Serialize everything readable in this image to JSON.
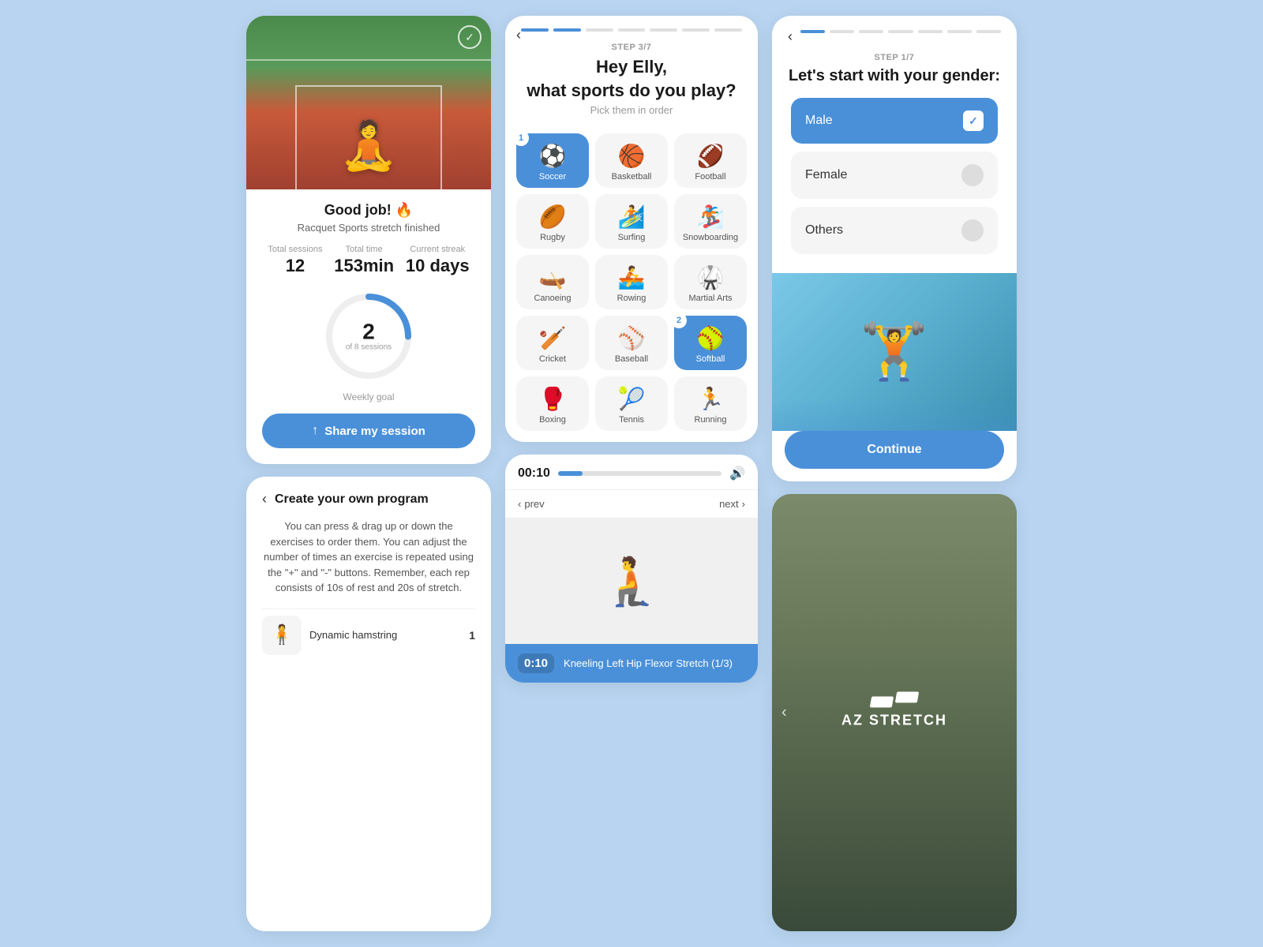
{
  "col_left": {
    "card_goodjob": {
      "title": "Good job! 🔥",
      "subtitle": "Racquet Sports stretch finished",
      "stats": [
        {
          "label": "Total sessions",
          "value": "12"
        },
        {
          "label": "Total time",
          "value": "153min"
        },
        {
          "label": "Current streak",
          "value": "10 days"
        }
      ],
      "ring_num": "2",
      "ring_sub": "of 8 sessions",
      "weekly_goal": "Weekly goal",
      "share_btn": "Share my session"
    },
    "card_create": {
      "back_arrow": "‹",
      "title": "Create your own program",
      "desc": "You can press & drag up or down the exercises to order them. You can adjust the number of times an exercise is repeated using the \"+\" and \"-\" buttons. Remember, each rep consists of 10s of rest and 20s of stretch.",
      "exercise": {
        "name": "Dynamic hamstring",
        "num": "1"
      }
    }
  },
  "col_mid": {
    "card_sports": {
      "step_label": "STEP 3/7",
      "header": "Hey Elly,",
      "header2": "what sports do you play?",
      "subheader": "Pick them in order",
      "sports": [
        {
          "emoji": "⚽",
          "name": "Soccer",
          "selected": true,
          "badge": "1"
        },
        {
          "emoji": "🏀",
          "name": "Basketball",
          "selected": false,
          "badge": ""
        },
        {
          "emoji": "🏈",
          "name": "Football",
          "selected": false,
          "badge": ""
        },
        {
          "emoji": "🏉",
          "name": "Rugby",
          "selected": false,
          "badge": ""
        },
        {
          "emoji": "🏄",
          "name": "Surfing",
          "selected": false,
          "badge": ""
        },
        {
          "emoji": "🏂",
          "name": "Snowboarding",
          "selected": false,
          "badge": ""
        },
        {
          "emoji": "🛶",
          "name": "Canoeing",
          "selected": false,
          "badge": ""
        },
        {
          "emoji": "🚣",
          "name": "Rowing",
          "selected": false,
          "badge": ""
        },
        {
          "emoji": "🥋",
          "name": "Martial Arts",
          "selected": false,
          "badge": ""
        },
        {
          "emoji": "🏏",
          "name": "Cricket",
          "selected": false,
          "badge": ""
        },
        {
          "emoji": "⚾",
          "name": "Baseball",
          "selected": false,
          "badge": ""
        },
        {
          "emoji": "🥎",
          "name": "Softball",
          "selected": true,
          "badge": "2"
        },
        {
          "emoji": "🥊",
          "name": "Boxing",
          "selected": false,
          "badge": ""
        },
        {
          "emoji": "🎾",
          "name": "Tennis",
          "selected": false,
          "badge": ""
        },
        {
          "emoji": "🏃",
          "name": "Running",
          "selected": false,
          "badge": ""
        }
      ]
    },
    "card_timer": {
      "time": "00:10",
      "sound_icon": "🔊",
      "prev": "prev",
      "next": "next",
      "exercise_time": "0:10",
      "exercise_desc": "Kneeling Left Hip Flexor Stretch (1/3)"
    }
  },
  "col_right": {
    "card_gender": {
      "step_label": "STEP 1/7",
      "title": "Let's start with your gender:",
      "options": [
        {
          "label": "Male",
          "selected": true
        },
        {
          "label": "Female",
          "selected": false
        },
        {
          "label": "Others",
          "selected": false
        }
      ],
      "continue_btn": "Continue"
    },
    "card_az": {
      "logo_text": "AZ STRETCH",
      "back_arrow": "‹"
    }
  },
  "icons": {
    "back": "‹",
    "forward": "›",
    "check": "✓",
    "share": "↑",
    "prev": "‹",
    "next": "›"
  }
}
